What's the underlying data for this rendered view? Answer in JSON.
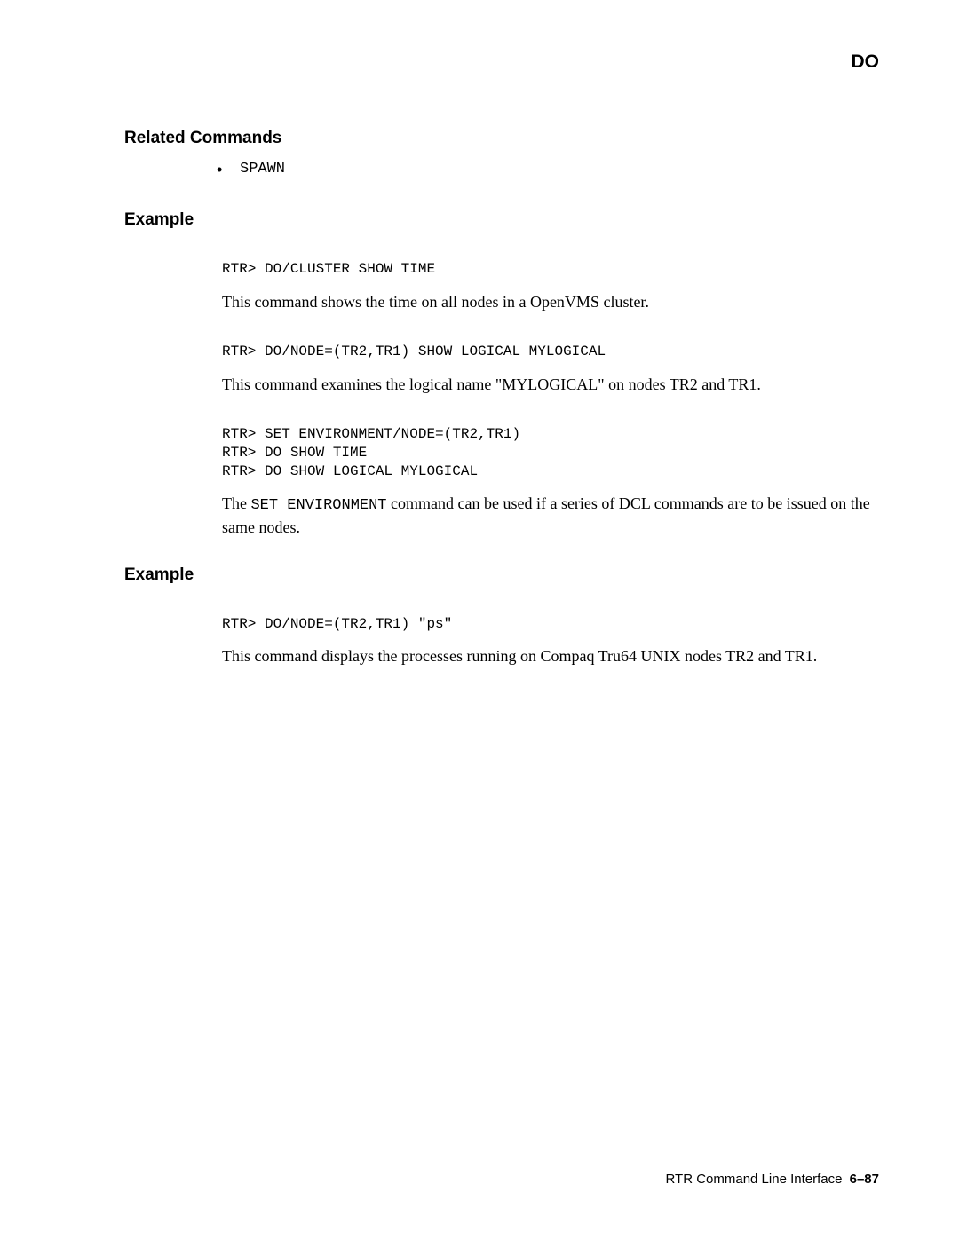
{
  "header": {
    "title": "DO"
  },
  "sections": {
    "related_heading": "Related Commands",
    "related_item": "SPAWN",
    "example1_heading": "Example",
    "code1": "RTR> DO/CLUSTER SHOW TIME",
    "para1": "This command shows the time on all nodes in a OpenVMS cluster.",
    "code2": "RTR> DO/NODE=(TR2,TR1) SHOW LOGICAL MYLOGICAL",
    "para2": "This command examines the logical name \"MYLOGICAL\" on nodes TR2 and TR1.",
    "code3": "RTR> SET ENVIRONMENT/NODE=(TR2,TR1)\nRTR> DO SHOW TIME\nRTR> DO SHOW LOGICAL MYLOGICAL",
    "para3_pre": "The ",
    "para3_mono": "SET ENVIRONMENT",
    "para3_post": " command can be used if a series of DCL commands are to be issued on the same nodes.",
    "example2_heading": "Example",
    "code4": "RTR> DO/NODE=(TR2,TR1) \"ps\"",
    "para4": "This command displays the processes running on Compaq Tru64 UNIX nodes TR2 and TR1."
  },
  "footer": {
    "text": "RTR Command Line Interface",
    "page": "6–87"
  }
}
